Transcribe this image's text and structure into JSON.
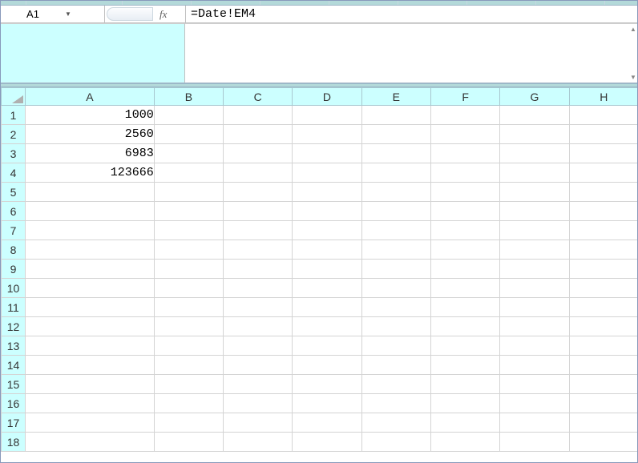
{
  "nameBox": {
    "value": "A1"
  },
  "formulaBar": {
    "fxLabel": "fx",
    "value": "=Date!EM4"
  },
  "columns": [
    "A",
    "B",
    "C",
    "D",
    "E",
    "F",
    "G",
    "H"
  ],
  "columnWidths": {
    "A": 160,
    "default": 86
  },
  "rowCount": 18,
  "cells": {
    "A1": "1000",
    "A2": "2560",
    "A3": "6983",
    "A4": "123666"
  }
}
